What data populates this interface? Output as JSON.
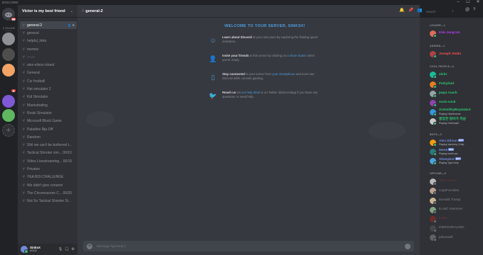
{
  "app": {
    "brand": "DISCORD"
  },
  "window_controls": [
    "–",
    "☐",
    "✕"
  ],
  "guilds": {
    "online_label": "0 ONLINE",
    "home_badge": "99",
    "items": [
      {
        "color": "#8e9297",
        "badge": ""
      },
      {
        "color": "#4e4e4e",
        "badge": ""
      },
      {
        "color": "#f2a365",
        "badge": ""
      },
      {
        "color": "#202225",
        "badge": "4"
      },
      {
        "color": "#7f59d6",
        "badge": ""
      },
      {
        "color": "#5fb75f",
        "badge": ""
      }
    ],
    "add_icon": "+"
  },
  "server": {
    "name": "Victor is my best friend"
  },
  "channels": [
    {
      "name": "general-2",
      "state": "selected"
    },
    {
      "name": "general",
      "state": "normal"
    },
    {
      "name": "helpful_links",
      "state": "normal"
    },
    {
      "name": "memes",
      "state": "normal"
    },
    {
      "name": "mute",
      "state": "muted"
    },
    {
      "name": "alex-elison island",
      "state": "normal"
    },
    {
      "name": "General",
      "state": "normal"
    },
    {
      "name": "Csr football",
      "state": "normal"
    },
    {
      "name": "Hat simulator 2",
      "state": "normal"
    },
    {
      "name": "Kid Simulator",
      "state": "normal"
    },
    {
      "name": "Masturbating",
      "state": "normal"
    },
    {
      "name": "Roski Simulator",
      "state": "normal"
    },
    {
      "name": "Microsoft Block Game",
      "state": "normal"
    },
    {
      "name": "Paladins Rip-Off",
      "state": "normal"
    },
    {
      "name": "Random",
      "state": "normal"
    },
    {
      "name": "Shit we can't be bothered t...",
      "state": "normal"
    },
    {
      "name": "Tactical Shooter sim... 00/10",
      "state": "normal"
    },
    {
      "name": "Video Livestreaming... 00/15",
      "state": "normal"
    },
    {
      "name": "Privates",
      "state": "normal"
    },
    {
      "name": "YEA BOI CHALLENGE",
      "state": "normal"
    },
    {
      "name": "We didn't give consent",
      "state": "normal"
    },
    {
      "name": "The Chromosome C... 00/20",
      "state": "normal"
    },
    {
      "name": "Not So Tactical Shooter Si...",
      "state": "normal"
    }
  ],
  "user": {
    "name": "SinksX",
    "tag": "#0318"
  },
  "chat": {
    "channel": "general-2",
    "welcome_title": "WELCOME TO YOUR SERVER, SINKSX!",
    "tips": [
      {
        "icon": "☺",
        "bold": "Learn about Discord",
        "text": " at your own pace by exploring the floating quest indicators.",
        "link": ""
      },
      {
        "icon": "👤",
        "bold": "Invite your friends",
        "text": " to this server by clicking on a ",
        "link": "share button",
        "after": " when you're ready."
      },
      {
        "icon": "▯",
        "bold": "Stay connected",
        "text": " to your server from ",
        "link": "your smartphone",
        "after": " and even use Discord while console gaming."
      },
      {
        "icon": "🐦",
        "bold": "Reach us",
        "text": " via ",
        "link": "our help desk",
        "after": " or on Twitter @discordapp if you have any questions or need help."
      }
    ],
    "composer_placeholder": "Message #general-2"
  },
  "search": {
    "placeholder": "Search"
  },
  "members": {
    "groups": [
      {
        "title": "LEADER—1",
        "items": [
          {
            "name": "Kim Jong Un",
            "color": "#c13eff",
            "status": "",
            "bot": false,
            "off": false,
            "avatar": "#e06d59"
          }
        ]
      },
      {
        "title": "ADMINS—1",
        "items": [
          {
            "name": "Joseph Stalin",
            "color": "#ff4d4d",
            "status": "",
            "bot": false,
            "off": false,
            "avatar": "#b24343"
          }
        ]
      },
      {
        "title": "COOL PEOPLE—6",
        "items": [
          {
            "name": "slchr",
            "color": "#2ecc71",
            "status": "",
            "bot": false,
            "off": false,
            "avatar": "#1abc9c"
          },
          {
            "name": "Fishyloid",
            "color": "#2ecc71",
            "status": "",
            "bot": false,
            "off": false,
            "avatar": "#e67e22"
          },
          {
            "name": "papa roach",
            "color": "#2ecc71",
            "status": "",
            "bot": false,
            "off": false,
            "avatar": "#95a5a6"
          },
          {
            "name": "sock-cock",
            "color": "#2ecc71",
            "status": "",
            "bot": false,
            "off": false,
            "avatar": "#8e44ad"
          },
          {
            "name": "XxSmithyBoy444xX",
            "color": "#2ecc71",
            "status": "Playing Hearthstone",
            "bot": false,
            "off": false,
            "avatar": "#3498db"
          },
          {
            "name": "중앙한 멍아가 하남",
            "color": "#2ecc71",
            "status": "Playing Overwatch",
            "bot": false,
            "off": false,
            "avatar": "#c9c9c9"
          }
        ]
      },
      {
        "title": "BOTS—3",
        "items": [
          {
            "name": "Alex Elison",
            "color": "#7289da",
            "status": "Playing !alexhelp | Help",
            "bot": true,
            "off": false,
            "avatar": "#f39c12",
            "bot_label": "BOT"
          },
          {
            "name": "Mee6",
            "color": "#7289da",
            "status": "Playing mee6.xyz",
            "bot": true,
            "off": false,
            "avatar": "#2c7a7b",
            "bot_label": "BOT"
          },
          {
            "name": "Sheepbot",
            "color": "#7289da",
            "status": "Playing Type !help",
            "bot": true,
            "off": false,
            "avatar": "#4aa3df",
            "bot_label": "BOT"
          }
        ]
      },
      {
        "title": "OFFLINE—9",
        "items": [
          {
            "name": "Tom Orcum",
            "color": "#b24343",
            "status": "",
            "bot": false,
            "off": true,
            "avatar": "#d0d0d0"
          },
          {
            "name": "CaptFreckles",
            "color": "#dcddde",
            "status": "",
            "bot": false,
            "off": true,
            "avatar": "#d4b5a0"
          },
          {
            "name": "Donald Trump",
            "color": "#dcddde",
            "status": "",
            "bot": false,
            "off": true,
            "avatar": "#e8c9a0"
          },
          {
            "name": "E=MC Hammer",
            "color": "#dcddde",
            "status": "",
            "bot": false,
            "off": true,
            "avatar": "#8fb58f"
          },
          {
            "name": "Lenin",
            "color": "#b24343",
            "status": "",
            "bot": false,
            "off": true,
            "avatar": "#7a2a2a"
          },
          {
            "name": "INEEDHEALING",
            "color": "#dcddde",
            "status": "",
            "bot": false,
            "off": true,
            "avatar": "#4a4a4a"
          },
          {
            "name": "jakeswell",
            "color": "#dcddde",
            "status": "",
            "bot": false,
            "off": true,
            "avatar": "#6a6a6a"
          }
        ]
      }
    ]
  }
}
